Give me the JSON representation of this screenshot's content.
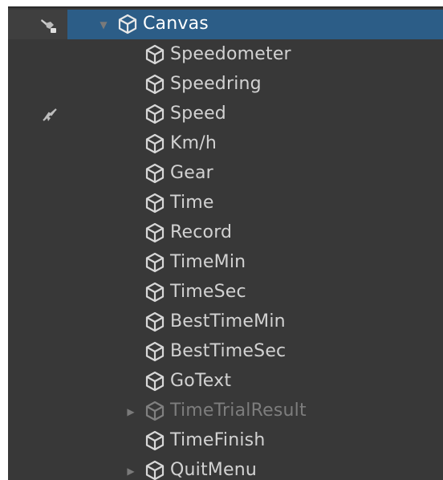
{
  "hierarchy": {
    "root": {
      "label": "Canvas",
      "expanded": true,
      "selected": true
    },
    "children": [
      {
        "label": "Speedometer",
        "has_children": false,
        "disabled": false
      },
      {
        "label": "Speedring",
        "has_children": false,
        "disabled": false
      },
      {
        "label": "Speed",
        "has_children": false,
        "disabled": false
      },
      {
        "label": "Km/h",
        "has_children": false,
        "disabled": false
      },
      {
        "label": "Gear",
        "has_children": false,
        "disabled": false
      },
      {
        "label": "Time",
        "has_children": false,
        "disabled": false
      },
      {
        "label": "Record",
        "has_children": false,
        "disabled": false
      },
      {
        "label": "TimeMin",
        "has_children": false,
        "disabled": false
      },
      {
        "label": "TimeSec",
        "has_children": false,
        "disabled": false
      },
      {
        "label": "BestTimeMin",
        "has_children": false,
        "disabled": false
      },
      {
        "label": "BestTimeSec",
        "has_children": false,
        "disabled": false
      },
      {
        "label": "GoText",
        "has_children": false,
        "disabled": false
      },
      {
        "label": "TimeTrialResult",
        "has_children": true,
        "disabled": true
      },
      {
        "label": "TimeFinish",
        "has_children": false,
        "disabled": false
      },
      {
        "label": "QuitMenu",
        "has_children": true,
        "disabled": false
      }
    ]
  },
  "icons": {
    "gameobject": "cube-icon",
    "expand_open": "triangle-down-icon",
    "expand_closed": "triangle-right-icon",
    "visibility": "eye-hidden-icon",
    "pickability": "hand-disabled-icon"
  },
  "colors": {
    "panel_bg": "#383838",
    "selection": "#2c5d87",
    "text": "#d2d2d2",
    "text_disabled": "#7d7d7d"
  }
}
